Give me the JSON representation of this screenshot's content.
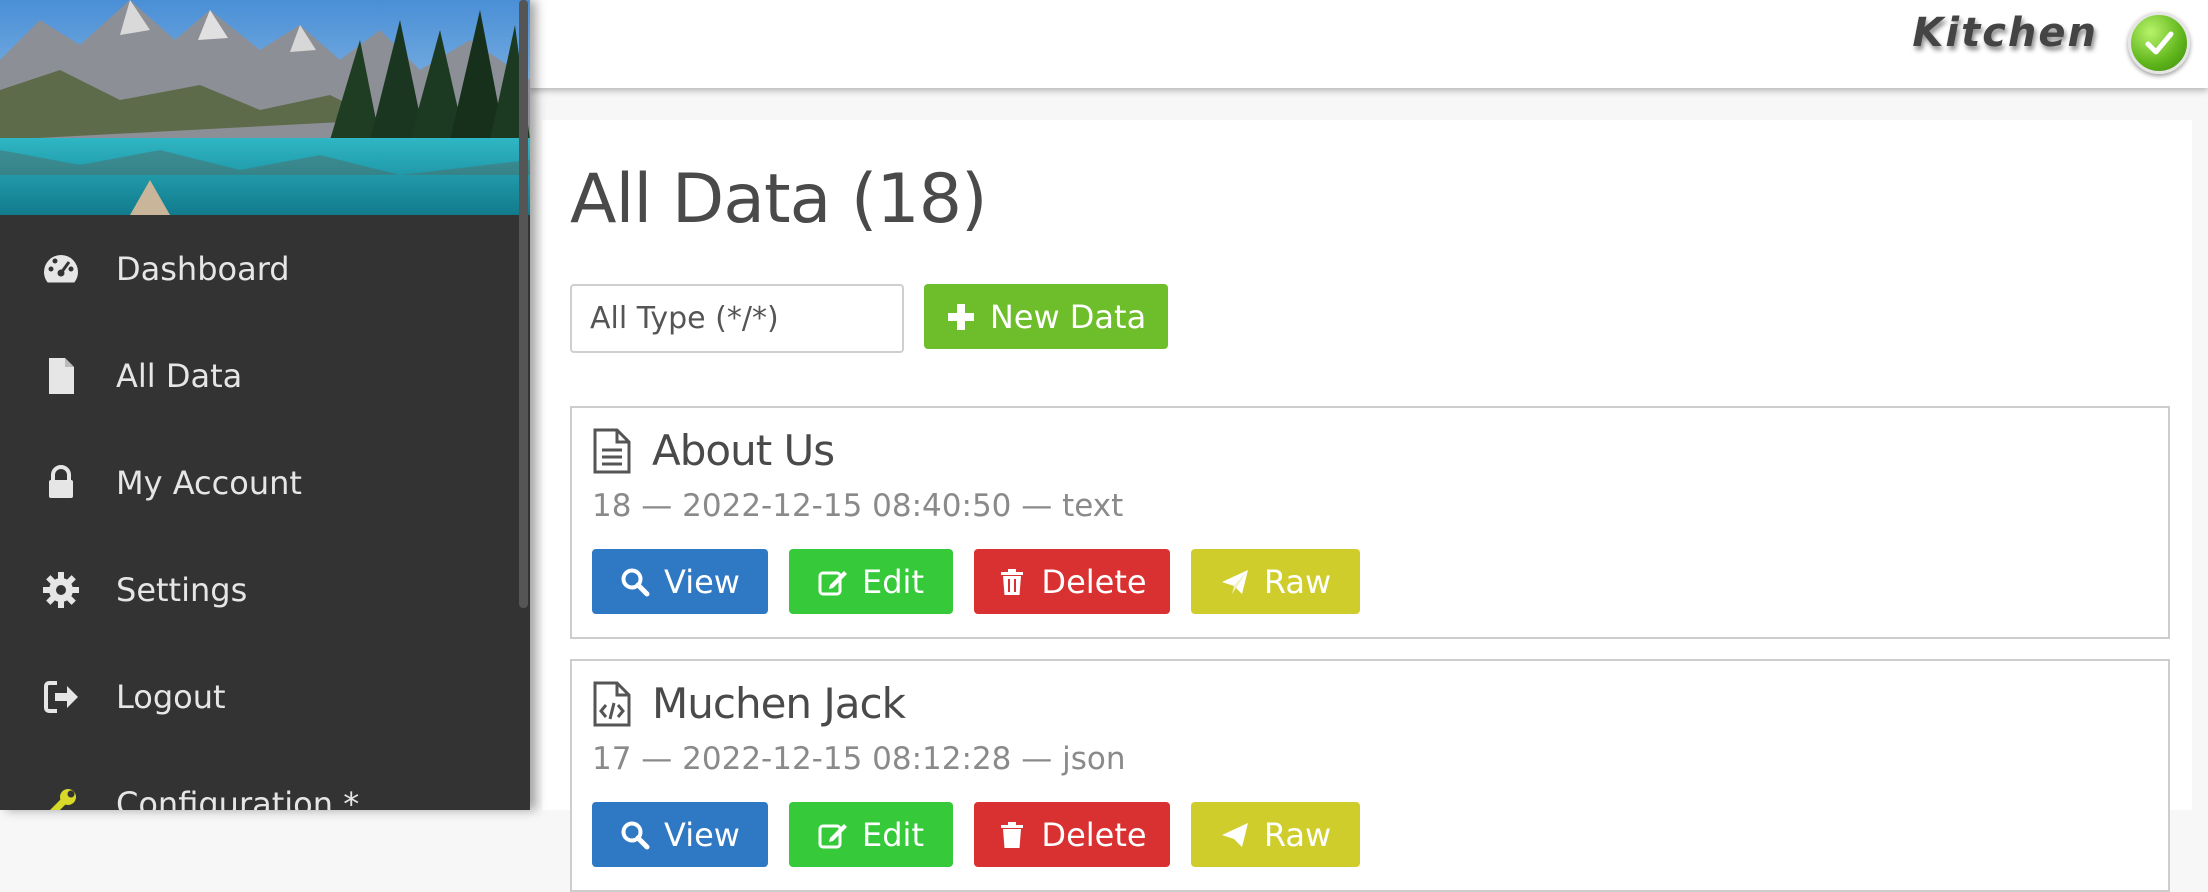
{
  "app": {
    "brand": "Kitchen"
  },
  "sidebar": {
    "items": [
      {
        "label": "Dashboard",
        "icon": "dashboard-icon"
      },
      {
        "label": "All Data",
        "icon": "file-icon"
      },
      {
        "label": "My Account",
        "icon": "lock-icon"
      },
      {
        "label": "Settings",
        "icon": "gear-icon"
      },
      {
        "label": "Logout",
        "icon": "logout-icon"
      },
      {
        "label": "Configuration *",
        "icon": "wrench-icon"
      }
    ]
  },
  "main": {
    "title": "All Data (18)",
    "type_filter": "All Type (*/*)",
    "new_button": "New Data",
    "actions": {
      "view": "View",
      "edit": "Edit",
      "delete": "Delete",
      "raw": "Raw"
    },
    "records": [
      {
        "title": "About Us",
        "meta": "18 — 2022-12-15 08:40:50 — text",
        "icon": "text-file-icon"
      },
      {
        "title": "Muchen Jack",
        "meta": "17 — 2022-12-15 08:12:28 — json",
        "icon": "code-file-icon"
      }
    ]
  },
  "colors": {
    "sidebar_bg": "#333333",
    "new_button": "#6ebe2b",
    "view": "#2f78c4",
    "edit": "#36c93a",
    "delete": "#d93131",
    "raw": "#cfcd2c"
  }
}
